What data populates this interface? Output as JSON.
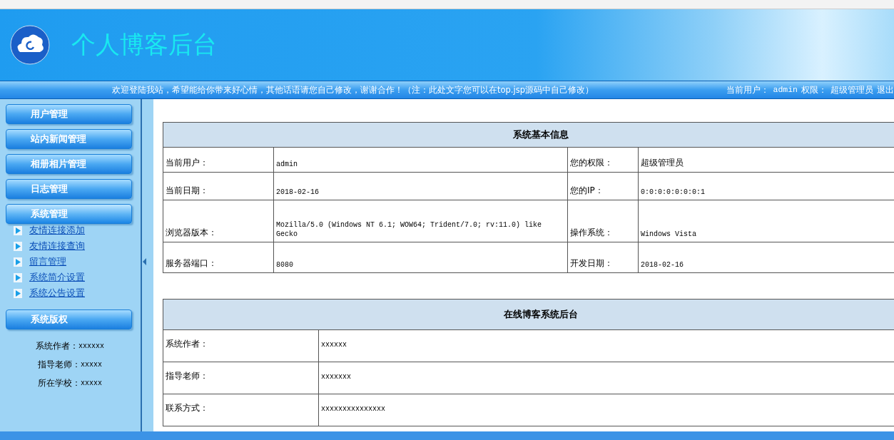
{
  "header": {
    "title": "个人博客后台"
  },
  "welcome_bar": {
    "message": "欢迎登陆我站，希望能给你带来好心情，其他话语请您自己修改，谢谢合作！（注：此处文字您可以在top.jsp源码中自己修改）",
    "user_label": "当前用户：",
    "user": "admin",
    "role_label": "权限：",
    "role": "超级管理员",
    "logout": "退出"
  },
  "sidebar": {
    "menus": [
      {
        "label": "用户管理",
        "expanded": false
      },
      {
        "label": "站内新闻管理",
        "expanded": false
      },
      {
        "label": "相册相片管理",
        "expanded": false
      },
      {
        "label": "日志管理",
        "expanded": false
      },
      {
        "label": "系统管理",
        "expanded": true,
        "links": [
          "友情连接添加",
          "友情连接查询",
          "留言管理",
          "系统简介设置",
          "系统公告设置"
        ]
      }
    ],
    "copyright": {
      "label": "系统版权",
      "lines": [
        {
          "label": "系统作者：",
          "value": "xxxxxx"
        },
        {
          "label": "指导老师：",
          "value": "xxxxx"
        },
        {
          "label": "所在学校：",
          "value": "xxxxx"
        }
      ]
    }
  },
  "info_table": {
    "title": "系统基本信息",
    "rows": [
      {
        "label_1": "当前用户：",
        "value_1": "admin",
        "label_2": "您的权限：",
        "value_2": "超级管理员"
      },
      {
        "label_1": "当前日期：",
        "value_1": "2018-02-16",
        "label_2": "您的IP：",
        "value_2": "0:0:0:0:0:0:0:1"
      },
      {
        "label_1": "浏览器版本：",
        "value_1": "Mozilla/5.0 (Windows NT 6.1; WOW64; Trident/7.0; rv:11.0) like Gecko",
        "label_2": "操作系统：",
        "value_2": "Windows Vista"
      },
      {
        "label_1": "服务器端口：",
        "value_1": "8080",
        "label_2": "开发日期：",
        "value_2": "2018-02-16"
      }
    ]
  },
  "about_table": {
    "title": "在线博客系统后台",
    "rows": [
      {
        "label": "系统作者：",
        "value": "xxxxxx"
      },
      {
        "label": "指导老师：",
        "value": "xxxxxxx"
      },
      {
        "label": "联系方式：",
        "value": "xxxxxxxxxxxxxxx"
      }
    ]
  }
}
